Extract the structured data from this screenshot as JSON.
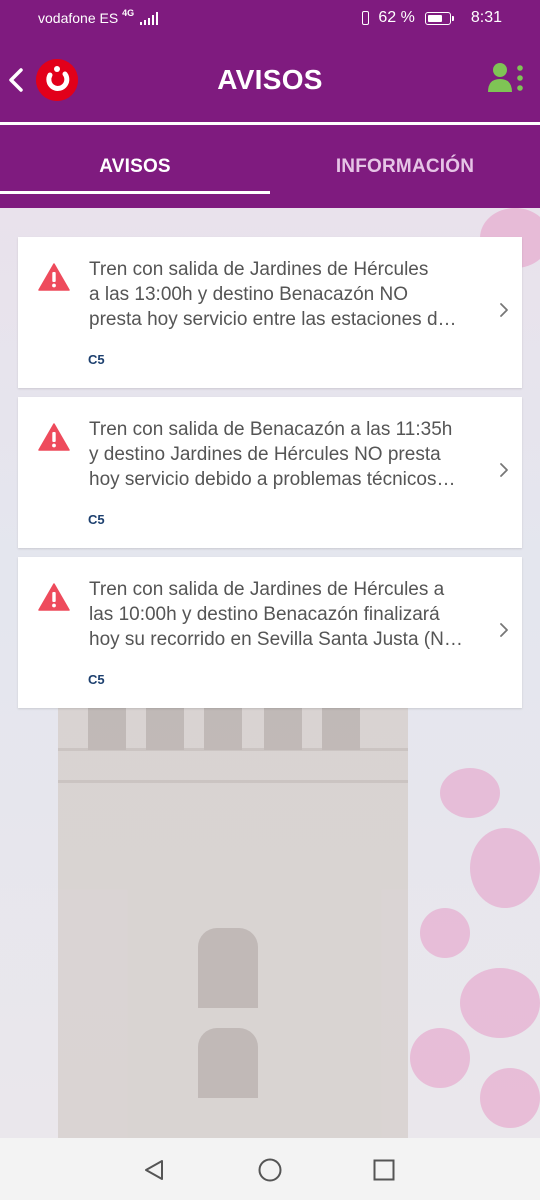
{
  "status_bar": {
    "carrier": "vodafone ES",
    "network": "4G",
    "battery": "62 %",
    "time": "8:31"
  },
  "header": {
    "title": "AVISOS",
    "back_icon": "chevron-left-icon",
    "logo_icon": "renfe-cercanias-logo",
    "user_icon": "user-menu-icon",
    "brand_color": "#7f1b7f"
  },
  "tabs": [
    {
      "label": "AVISOS",
      "selected": true
    },
    {
      "label": "INFORMACIÓN",
      "selected": false
    }
  ],
  "notices": [
    {
      "lines": [
        "Tren con salida de Jardines de Hércules",
        "a las 13:00h y destino Benacazón NO",
        "presta hoy servicio entre las estaciones d…"
      ],
      "line": "C5",
      "icon": "warning-icon"
    },
    {
      "lines": [
        "Tren con salida de Benacazón a las 11:35h",
        "y destino Jardines de Hércules NO presta",
        "hoy servicio debido a problemas técnicos…"
      ],
      "line": "C5",
      "icon": "warning-icon"
    },
    {
      "lines": [
        "Tren con salida de Jardines de Hércules a",
        "las 10:00h y destino Benacazón finalizará",
        "hoy su recorrido en Sevilla Santa Justa (N…"
      ],
      "line": "C5",
      "icon": "warning-icon"
    }
  ],
  "nav_bar": {
    "back_icon": "triangle-back-icon",
    "home_icon": "circle-home-icon",
    "recent_icon": "square-recent-icon"
  }
}
